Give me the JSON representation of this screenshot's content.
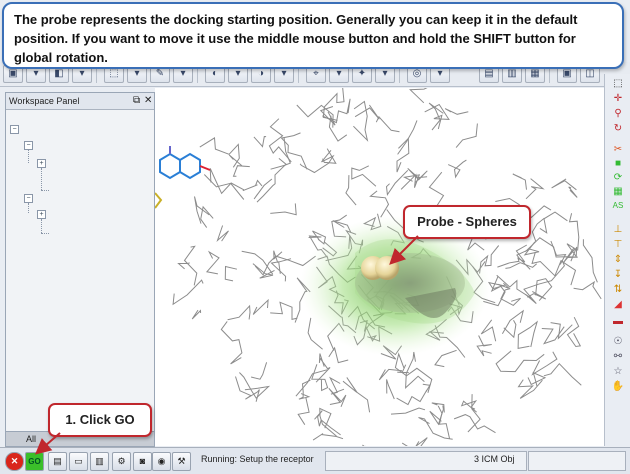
{
  "banner": {
    "text": "The probe represents the docking starting position. Generally you can keep it in the default position. If you want to move it use the middle mouse button and hold the SHIFT button for global rotation."
  },
  "workspace_panel": {
    "title": "Workspace Panel",
    "float_icon": "restore-icon",
    "close_icon": "close-icon",
    "tab_label": "All"
  },
  "callouts": {
    "probe_label": "Probe - Spheres",
    "go_label": "1. Click GO"
  },
  "status_bar": {
    "go_label": "GO",
    "status_text": "Running: Setup the receptor",
    "object_count": "3 ICM Obj"
  },
  "colors": {
    "callout_border": "#c0272d",
    "banner_border": "#3a6fb7",
    "go_button": "#3bbf2a",
    "stop_button": "#d9261c",
    "probe_sphere": "#efe2a6",
    "pocket_surface": "#7ecb5a"
  }
}
